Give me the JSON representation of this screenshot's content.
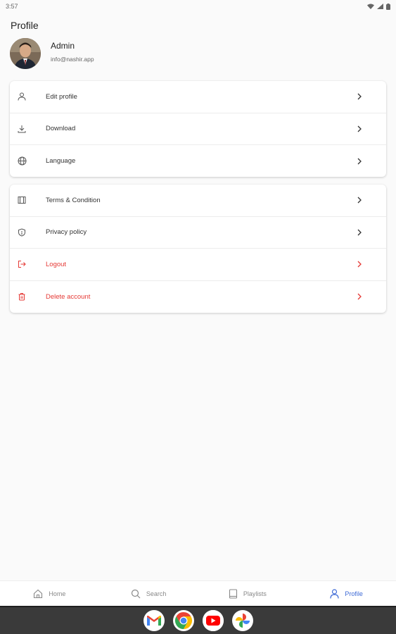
{
  "status_bar": {
    "time": "3:57"
  },
  "page": {
    "title": "Profile"
  },
  "profile": {
    "name": "Admin",
    "email": "info@nashir.app"
  },
  "menu_group_1": [
    {
      "label": "Edit profile",
      "icon": "person-icon"
    },
    {
      "label": "Download",
      "icon": "download-icon"
    },
    {
      "label": "Language",
      "icon": "globe-icon"
    }
  ],
  "menu_group_2": [
    {
      "label": "Terms & Condition",
      "icon": "book-icon"
    },
    {
      "label": "Privacy policy",
      "icon": "shield-icon"
    },
    {
      "label": "Logout",
      "icon": "logout-icon"
    },
    {
      "label": "Delete account",
      "icon": "trash-icon"
    }
  ],
  "bottom_nav": [
    {
      "label": "Home",
      "icon": "home-icon",
      "active": false
    },
    {
      "label": "Search",
      "icon": "search-icon",
      "active": false
    },
    {
      "label": "Playlists",
      "icon": "playlist-icon",
      "active": false
    },
    {
      "label": "Profile",
      "icon": "person-icon",
      "active": true
    }
  ],
  "taskbar_apps": [
    "gmail-icon",
    "chrome-icon",
    "youtube-icon",
    "photos-icon"
  ],
  "colors": {
    "accent": "#3f6bd6",
    "danger": "#e53935",
    "background": "#fafafa"
  }
}
